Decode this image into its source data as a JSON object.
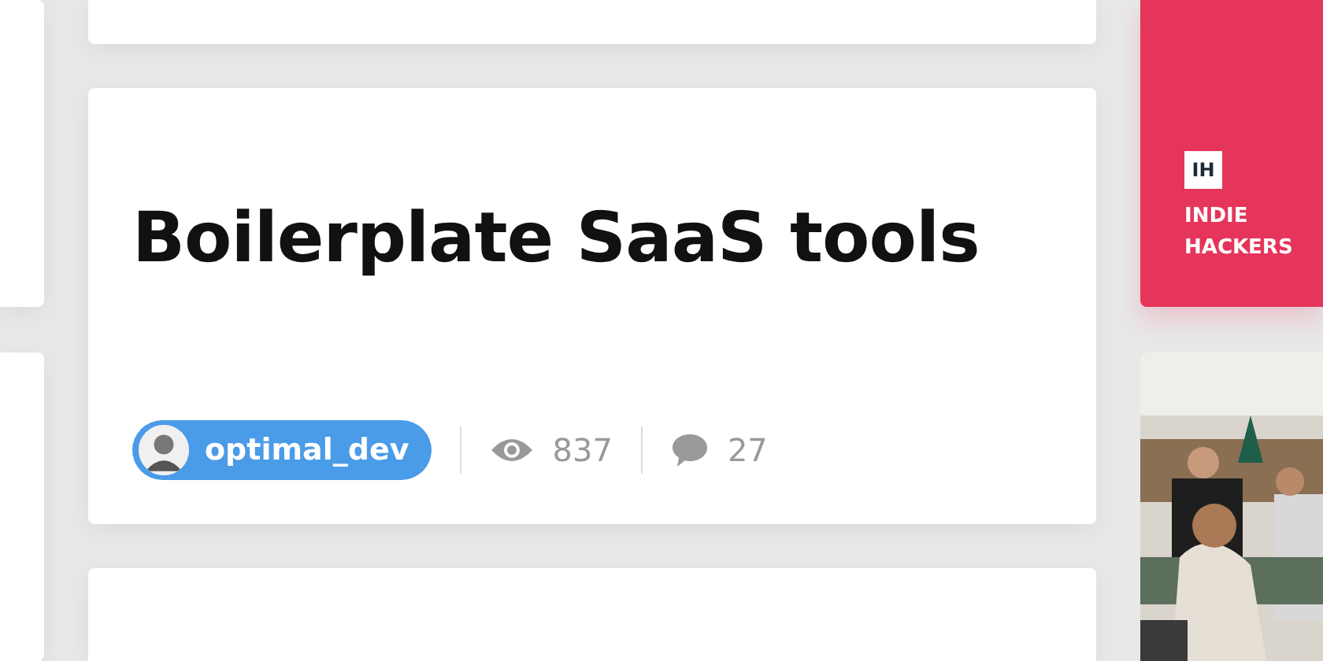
{
  "post": {
    "title": "Boilerplate SaaS tools",
    "author": "optimal_dev",
    "views": "837",
    "comments": "27"
  },
  "sponsor": {
    "logo": "IH",
    "name": "INDIE HACKERS"
  }
}
